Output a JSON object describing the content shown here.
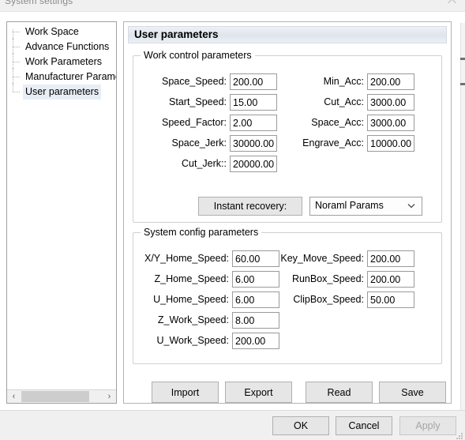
{
  "window": {
    "title": "System settings",
    "collapse_icon": "chevron-up-icon"
  },
  "tree": {
    "items": [
      {
        "label": "Work Space",
        "selected": false
      },
      {
        "label": "Advance Functions",
        "selected": false
      },
      {
        "label": "Work Parameters",
        "selected": false
      },
      {
        "label": "Manufacturer Paramet",
        "selected": false
      },
      {
        "label": "User parameters",
        "selected": true
      }
    ],
    "scrollbar": {
      "left_arrow": "‹",
      "right_arrow": "›"
    }
  },
  "page": {
    "header": "User parameters"
  },
  "work_control": {
    "title": "Work control parameters",
    "left_fields": [
      {
        "label": "Space_Speed:",
        "value": "200.00"
      },
      {
        "label": "Start_Speed:",
        "value": "15.00"
      },
      {
        "label": "Speed_Factor:",
        "value": "2.00"
      },
      {
        "label": "Space_Jerk:",
        "value": "30000.00"
      },
      {
        "label": "Cut_Jerk::",
        "value": "20000.00"
      }
    ],
    "right_fields": [
      {
        "label": "Min_Acc:",
        "value": "200.00"
      },
      {
        "label": "Cut_Acc:",
        "value": "3000.00"
      },
      {
        "label": "Space_Acc:",
        "value": "3000.00"
      },
      {
        "label": "Engrave_Acc:",
        "value": "10000.00"
      }
    ],
    "instant_recovery_label": "Instant recovery:",
    "params_combo": {
      "value": "Noraml Params",
      "arrow_icon": "chevron-down-icon"
    }
  },
  "system_config": {
    "title": "System config parameters",
    "left_fields": [
      {
        "label": "X/Y_Home_Speed:",
        "value": "60.00"
      },
      {
        "label": "Z_Home_Speed:",
        "value": "6.00"
      },
      {
        "label": "U_Home_Speed:",
        "value": "6.00"
      },
      {
        "label": "Z_Work_Speed:",
        "value": "8.00"
      },
      {
        "label": "U_Work_Speed:",
        "value": "200.00"
      }
    ],
    "right_fields": [
      {
        "label": "Key_Move_Speed:",
        "value": "200.00"
      },
      {
        "label": "RunBox_Speed:",
        "value": "200.00"
      },
      {
        "label": "ClipBox_Speed:",
        "value": "50.00"
      }
    ]
  },
  "actions": {
    "import": "Import",
    "export": "Export",
    "read": "Read",
    "save": "Save"
  },
  "footer": {
    "ok": "OK",
    "cancel": "Cancel",
    "apply": "Apply",
    "apply_disabled": true
  },
  "colors": {
    "dialog_bg": "#f0f0f0",
    "panel_bg": "#ffffff",
    "header_gradient_start": "#eef1f6",
    "header_gradient_end": "#dfe5ed",
    "selection": "#e8eef5",
    "button_face": "#e6e6e6",
    "disabled_text": "#a6a6a6",
    "border": "#a0a0a0"
  }
}
